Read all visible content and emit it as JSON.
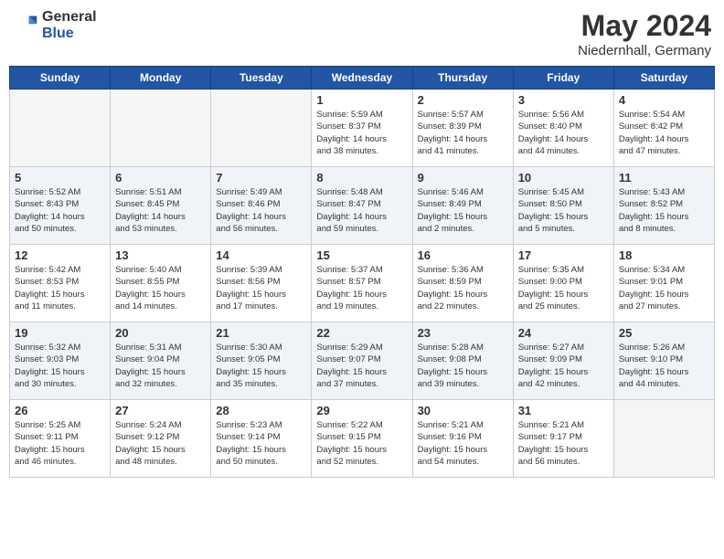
{
  "header": {
    "logo_general": "General",
    "logo_blue": "Blue",
    "month_year": "May 2024",
    "location": "Niedernhall, Germany"
  },
  "days_of_week": [
    "Sunday",
    "Monday",
    "Tuesday",
    "Wednesday",
    "Thursday",
    "Friday",
    "Saturday"
  ],
  "weeks": [
    [
      {
        "num": "",
        "info": ""
      },
      {
        "num": "",
        "info": ""
      },
      {
        "num": "",
        "info": ""
      },
      {
        "num": "1",
        "info": "Sunrise: 5:59 AM\nSunset: 8:37 PM\nDaylight: 14 hours\nand 38 minutes."
      },
      {
        "num": "2",
        "info": "Sunrise: 5:57 AM\nSunset: 8:39 PM\nDaylight: 14 hours\nand 41 minutes."
      },
      {
        "num": "3",
        "info": "Sunrise: 5:56 AM\nSunset: 8:40 PM\nDaylight: 14 hours\nand 44 minutes."
      },
      {
        "num": "4",
        "info": "Sunrise: 5:54 AM\nSunset: 8:42 PM\nDaylight: 14 hours\nand 47 minutes."
      }
    ],
    [
      {
        "num": "5",
        "info": "Sunrise: 5:52 AM\nSunset: 8:43 PM\nDaylight: 14 hours\nand 50 minutes."
      },
      {
        "num": "6",
        "info": "Sunrise: 5:51 AM\nSunset: 8:45 PM\nDaylight: 14 hours\nand 53 minutes."
      },
      {
        "num": "7",
        "info": "Sunrise: 5:49 AM\nSunset: 8:46 PM\nDaylight: 14 hours\nand 56 minutes."
      },
      {
        "num": "8",
        "info": "Sunrise: 5:48 AM\nSunset: 8:47 PM\nDaylight: 14 hours\nand 59 minutes."
      },
      {
        "num": "9",
        "info": "Sunrise: 5:46 AM\nSunset: 8:49 PM\nDaylight: 15 hours\nand 2 minutes."
      },
      {
        "num": "10",
        "info": "Sunrise: 5:45 AM\nSunset: 8:50 PM\nDaylight: 15 hours\nand 5 minutes."
      },
      {
        "num": "11",
        "info": "Sunrise: 5:43 AM\nSunset: 8:52 PM\nDaylight: 15 hours\nand 8 minutes."
      }
    ],
    [
      {
        "num": "12",
        "info": "Sunrise: 5:42 AM\nSunset: 8:53 PM\nDaylight: 15 hours\nand 11 minutes."
      },
      {
        "num": "13",
        "info": "Sunrise: 5:40 AM\nSunset: 8:55 PM\nDaylight: 15 hours\nand 14 minutes."
      },
      {
        "num": "14",
        "info": "Sunrise: 5:39 AM\nSunset: 8:56 PM\nDaylight: 15 hours\nand 17 minutes."
      },
      {
        "num": "15",
        "info": "Sunrise: 5:37 AM\nSunset: 8:57 PM\nDaylight: 15 hours\nand 19 minutes."
      },
      {
        "num": "16",
        "info": "Sunrise: 5:36 AM\nSunset: 8:59 PM\nDaylight: 15 hours\nand 22 minutes."
      },
      {
        "num": "17",
        "info": "Sunrise: 5:35 AM\nSunset: 9:00 PM\nDaylight: 15 hours\nand 25 minutes."
      },
      {
        "num": "18",
        "info": "Sunrise: 5:34 AM\nSunset: 9:01 PM\nDaylight: 15 hours\nand 27 minutes."
      }
    ],
    [
      {
        "num": "19",
        "info": "Sunrise: 5:32 AM\nSunset: 9:03 PM\nDaylight: 15 hours\nand 30 minutes."
      },
      {
        "num": "20",
        "info": "Sunrise: 5:31 AM\nSunset: 9:04 PM\nDaylight: 15 hours\nand 32 minutes."
      },
      {
        "num": "21",
        "info": "Sunrise: 5:30 AM\nSunset: 9:05 PM\nDaylight: 15 hours\nand 35 minutes."
      },
      {
        "num": "22",
        "info": "Sunrise: 5:29 AM\nSunset: 9:07 PM\nDaylight: 15 hours\nand 37 minutes."
      },
      {
        "num": "23",
        "info": "Sunrise: 5:28 AM\nSunset: 9:08 PM\nDaylight: 15 hours\nand 39 minutes."
      },
      {
        "num": "24",
        "info": "Sunrise: 5:27 AM\nSunset: 9:09 PM\nDaylight: 15 hours\nand 42 minutes."
      },
      {
        "num": "25",
        "info": "Sunrise: 5:26 AM\nSunset: 9:10 PM\nDaylight: 15 hours\nand 44 minutes."
      }
    ],
    [
      {
        "num": "26",
        "info": "Sunrise: 5:25 AM\nSunset: 9:11 PM\nDaylight: 15 hours\nand 46 minutes."
      },
      {
        "num": "27",
        "info": "Sunrise: 5:24 AM\nSunset: 9:12 PM\nDaylight: 15 hours\nand 48 minutes."
      },
      {
        "num": "28",
        "info": "Sunrise: 5:23 AM\nSunset: 9:14 PM\nDaylight: 15 hours\nand 50 minutes."
      },
      {
        "num": "29",
        "info": "Sunrise: 5:22 AM\nSunset: 9:15 PM\nDaylight: 15 hours\nand 52 minutes."
      },
      {
        "num": "30",
        "info": "Sunrise: 5:21 AM\nSunset: 9:16 PM\nDaylight: 15 hours\nand 54 minutes."
      },
      {
        "num": "31",
        "info": "Sunrise: 5:21 AM\nSunset: 9:17 PM\nDaylight: 15 hours\nand 56 minutes."
      },
      {
        "num": "",
        "info": ""
      }
    ]
  ]
}
